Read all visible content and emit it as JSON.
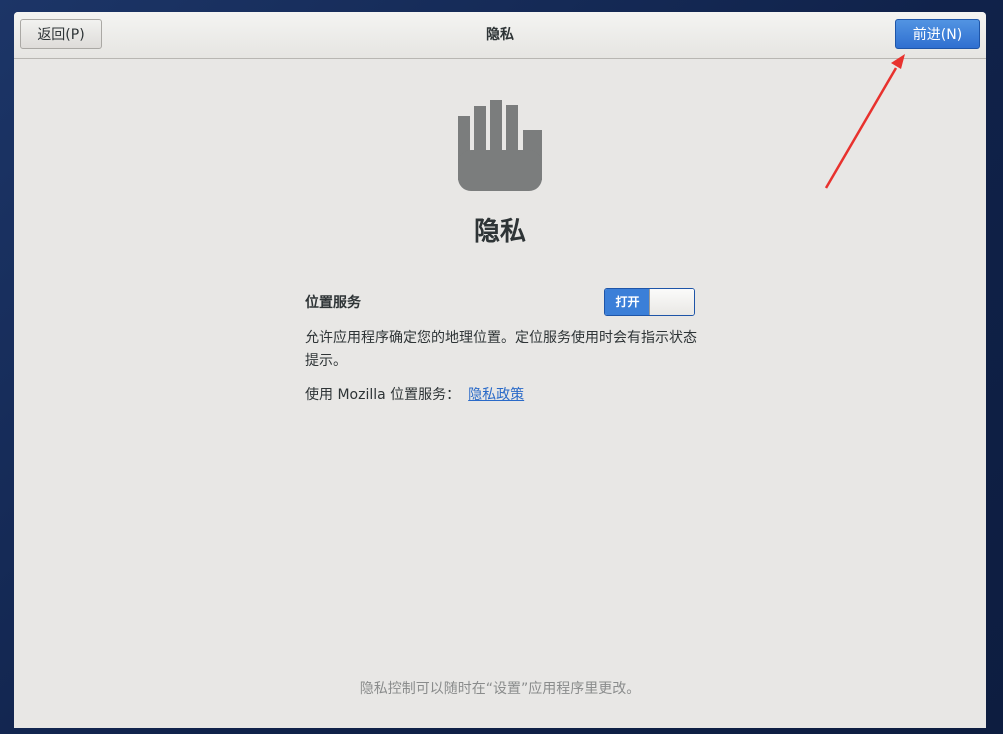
{
  "header": {
    "title": "隐私",
    "back_label": "返回(P)",
    "next_label": "前进(N)"
  },
  "main": {
    "icon": "privacy-hand-icon",
    "title": "隐私",
    "location": {
      "label": "位置服务",
      "toggle_state": "打开",
      "toggle_on": true,
      "description": "允许应用程序确定您的地理位置。定位服务使用时会有指示状态提示。",
      "mozilla_prefix": "使用 Mozilla 位置服务：",
      "privacy_link": "隐私政策"
    },
    "footer_note": "隐私控制可以随时在“设置”应用程序里更改。"
  },
  "colors": {
    "accent": "#3b7fd8",
    "link": "#2a6ac8",
    "annotation_arrow": "#e8322e",
    "icon_gray": "#7b7d7d"
  }
}
